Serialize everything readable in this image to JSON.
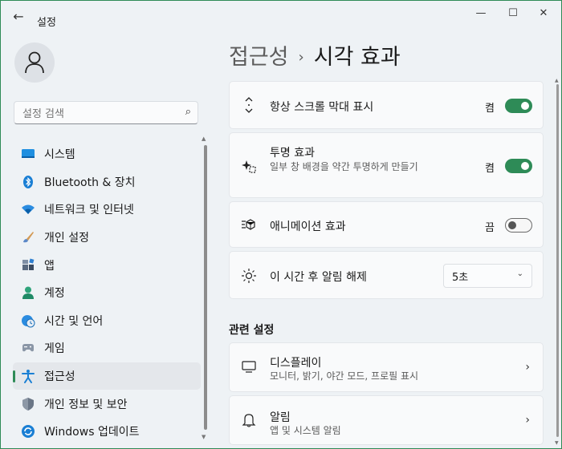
{
  "window": {
    "app_title": "설정",
    "back_icon": "arrow-left-icon",
    "controls": {
      "minimize": "—",
      "maximize": "☐",
      "close": "✕"
    }
  },
  "user": {
    "avatar_icon": "person-icon"
  },
  "search": {
    "placeholder": "설정 검색",
    "icon": "search-icon"
  },
  "sidebar": {
    "items": [
      {
        "label": "시스템",
        "icon": "monitor-icon",
        "selected": false
      },
      {
        "label": "Bluetooth & 장치",
        "icon": "bluetooth-icon",
        "selected": false
      },
      {
        "label": "네트워크 및 인터넷",
        "icon": "wifi-icon",
        "selected": false
      },
      {
        "label": "개인 설정",
        "icon": "brush-icon",
        "selected": false
      },
      {
        "label": "앱",
        "icon": "apps-icon",
        "selected": false
      },
      {
        "label": "계정",
        "icon": "account-icon",
        "selected": false
      },
      {
        "label": "시간 및 언어",
        "icon": "clock-globe-icon",
        "selected": false
      },
      {
        "label": "게임",
        "icon": "gamepad-icon",
        "selected": false
      },
      {
        "label": "접근성",
        "icon": "accessibility-icon",
        "selected": true
      },
      {
        "label": "개인 정보 및 보안",
        "icon": "shield-icon",
        "selected": false
      },
      {
        "label": "Windows 업데이트",
        "icon": "update-icon",
        "selected": false
      }
    ]
  },
  "breadcrumb": {
    "parent": "접근성",
    "separator": "›",
    "current": "시각 효과"
  },
  "settings": {
    "scrollbars": {
      "title": "항상 스크롤 막대 표시",
      "state": "켬",
      "on": true,
      "icon": "scroll-arrows-icon"
    },
    "transparency": {
      "title": "투명 효과",
      "description": "일부 창 배경을 약간 투명하게 만들기",
      "state": "켬",
      "on": true,
      "icon": "sparkle-icon"
    },
    "animation": {
      "title": "애니메이션 효과",
      "state": "끔",
      "on": false,
      "icon": "animation-icon"
    },
    "notifications": {
      "title": "이 시간 후 알림 해제",
      "value": "5초",
      "icon": "sun-icon"
    }
  },
  "related": {
    "heading": "관련 설정",
    "items": [
      {
        "title": "디스플레이",
        "description": "모니터, 밝기, 야간 모드, 프로필 표시",
        "icon": "display-icon"
      },
      {
        "title": "알림",
        "description": "앱 및 시스템 알림",
        "icon": "bell-icon"
      }
    ]
  },
  "colors": {
    "accent": "#2e8b57"
  }
}
